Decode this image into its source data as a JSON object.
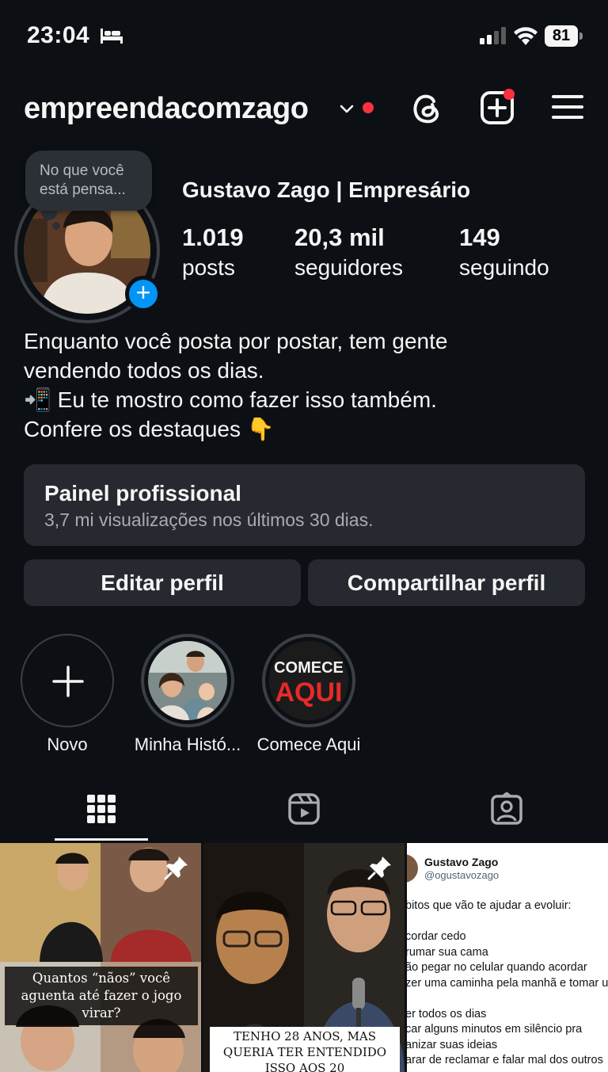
{
  "status_bar": {
    "time": "23:04",
    "battery": "81"
  },
  "header": {
    "username": "empreendacomzago"
  },
  "profile": {
    "note": "No que você está pensa...",
    "display_name": "Gustavo Zago | Empresário",
    "stats": [
      {
        "value": "1.019",
        "label": "posts"
      },
      {
        "value": "20,3 mil",
        "label": "seguidores"
      },
      {
        "value": "149",
        "label": "seguindo"
      }
    ],
    "bio": [
      "Enquanto você posta por postar, tem gente",
      "vendendo todos os dias.",
      "📲 Eu te mostro como fazer isso também.",
      "Confere os destaques  👇"
    ]
  },
  "dashboard": {
    "title": "Painel profissional",
    "subtitle": "3,7 mi visualizações nos últimos 30 dias."
  },
  "buttons": {
    "edit": "Editar perfil",
    "share": "Compartilhar perfil"
  },
  "highlights": [
    {
      "label": "Novo"
    },
    {
      "label": "Minha Histó..."
    },
    {
      "label": "Comece Aqui",
      "cover_text": [
        "COMECE",
        "AQUI"
      ]
    }
  ],
  "posts": [
    {
      "caption": "Quantos “nãos” você aguenta até fazer o jogo virar?",
      "pinned": true
    },
    {
      "caption": "TENHO 28 ANOS, MAS QUERIA TER ENTENDIDO ISSO AOS 20",
      "pinned": true
    },
    {
      "tweet_name": "Gustavo Zago",
      "tweet_handle": "@ogustavozago",
      "tweet_lines": [
        "bitos que vão te ajudar a evoluir:",
        "",
        "cordar cedo",
        "rumar sua cama",
        "ão pegar no celular quando acordar",
        "zer uma caminha pela manhã e tomar u",
        "",
        "er todos os dias",
        "car alguns minutos em silêncio pra",
        "anizar suas ideias",
        "arar de reclamar e falar mal dos outros"
      ]
    }
  ],
  "colors": {
    "background": "#0c1014",
    "accent": "#0095f6",
    "notification": "#ff3040",
    "surface": "#262a30"
  }
}
